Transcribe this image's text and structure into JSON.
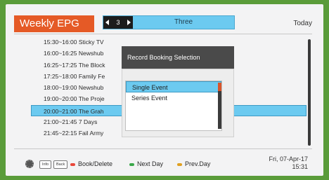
{
  "header": {
    "title": "Weekly EPG",
    "channel_number": "3",
    "channel_name": "Three",
    "day_label": "Today"
  },
  "programs": [
    {
      "text": "15:30~16:00 Sticky TV"
    },
    {
      "text": "16:00~16:25 Newshub"
    },
    {
      "text": "16:25~17:25 The Block"
    },
    {
      "text": "17:25~18:00 Family Fe"
    },
    {
      "text": "18:00~19:00 Newshub"
    },
    {
      "text": "19:00~20:00 The Proje"
    },
    {
      "text": "20:00~21:00 The Grah"
    },
    {
      "text": "21:00~21:45 7 Days"
    },
    {
      "text": "21:45~22:15 Fail Army"
    }
  ],
  "selected_program_index": 6,
  "dialog": {
    "title": "Record Booking Selection",
    "options": [
      "Single Event",
      "Series Event"
    ],
    "selected_option_index": 0
  },
  "footer": {
    "keys": [
      "Info",
      "Back"
    ],
    "actions": [
      {
        "label": "Book/Delete",
        "color": "#e8483a"
      },
      {
        "label": "Next Day",
        "color": "#3aa84a"
      },
      {
        "label": "Prev.Day",
        "color": "#e0a020"
      }
    ],
    "date": "Fri, 07-Apr-17",
    "time": "15:31"
  },
  "colors": {
    "accent": "#e55a26",
    "highlight": "#6ccaf0",
    "dialog_header": "#4a4a4a"
  }
}
